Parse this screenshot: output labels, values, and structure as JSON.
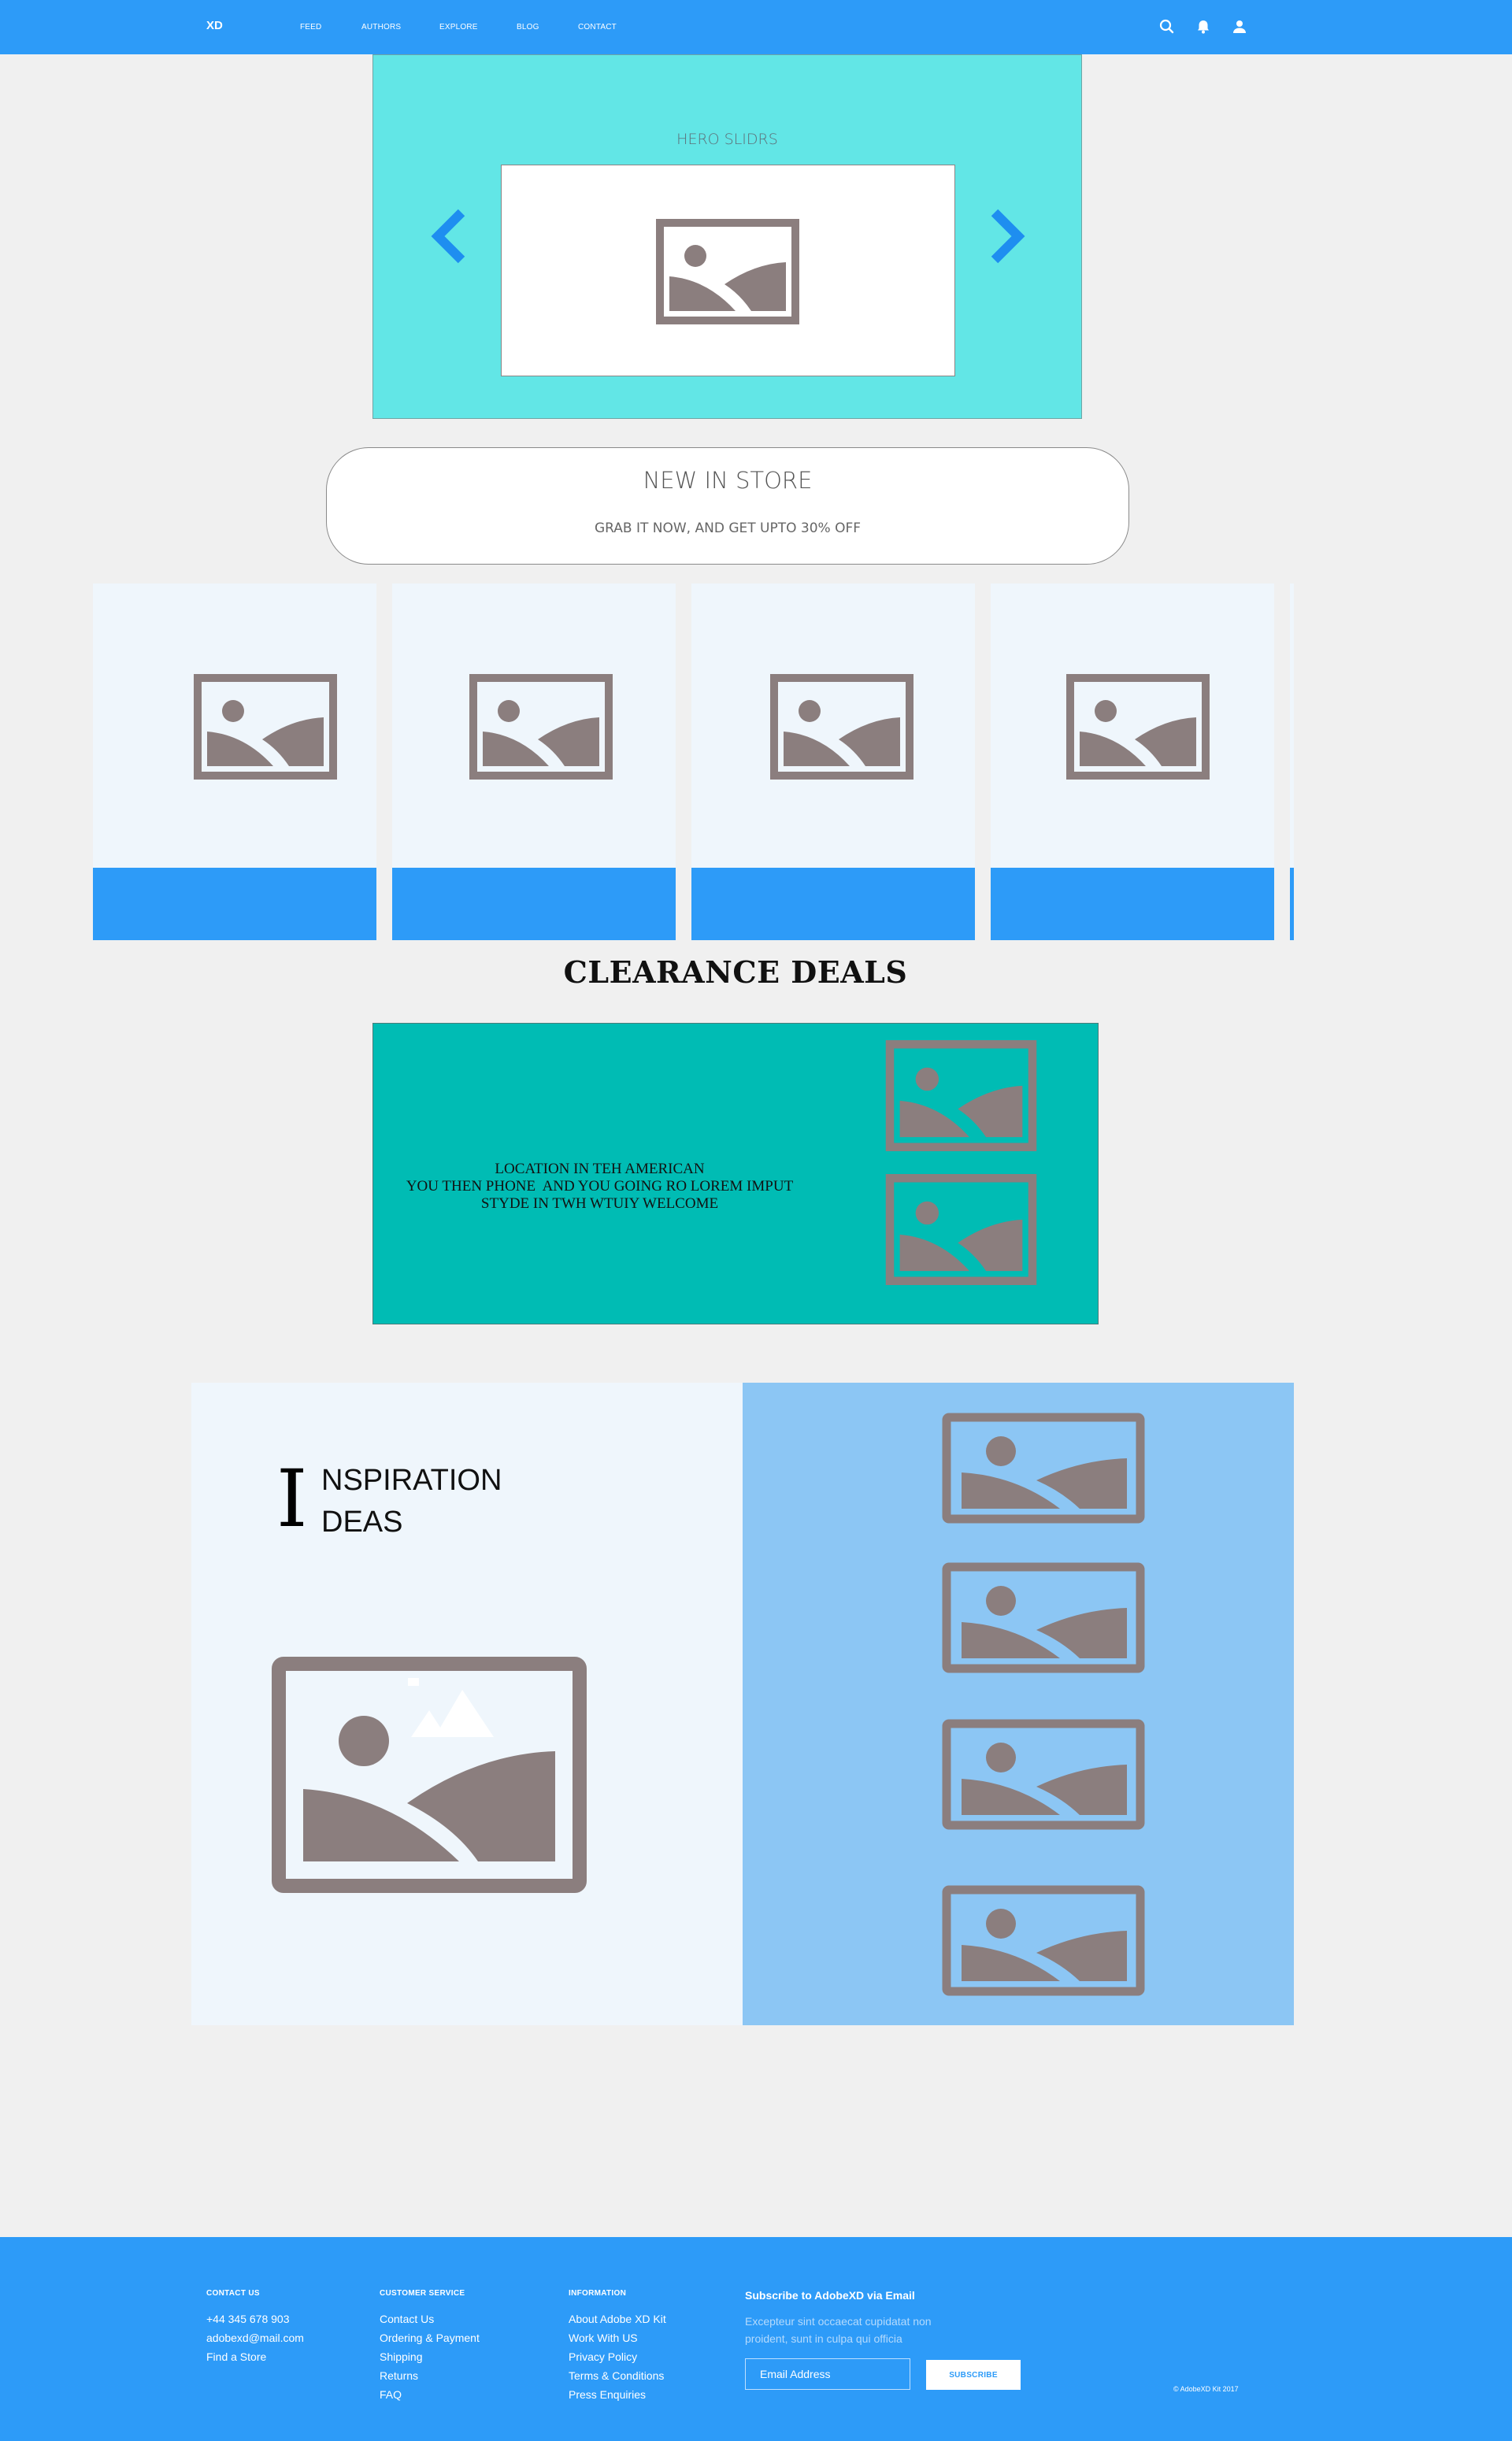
{
  "nav": {
    "logo": "XD",
    "links": [
      "FEED",
      "AUTHORS",
      "EXPLORE",
      "BLOG",
      "CONTACT"
    ],
    "icons": [
      "search-icon",
      "bell-icon",
      "user-icon"
    ]
  },
  "hero": {
    "title": "HERO SLIDRS",
    "prev_icon": "chevron-left-icon",
    "next_icon": "chevron-right-icon"
  },
  "store": {
    "title": "NEW IN STORE",
    "subtitle": "GRAB IT NOW, AND GET UPTO 30% OFF"
  },
  "clearance": {
    "title": "CLEARANCE DEALS",
    "text": "LOCATION IN TEH AMERICAN\nYOU THEN PHONE  AND YOU GOING RO LOREM IMPUT\nSTYDE IN TWH WTUIY WELCOME"
  },
  "inspiration": {
    "drop_cap": "I",
    "line1": "NSPIRATION",
    "line2": "DEAS"
  },
  "footer": {
    "contact": {
      "heading": "CONTACT US",
      "items": [
        "+44 345 678 903",
        "adobexd@mail.com",
        "Find a Store"
      ]
    },
    "customer": {
      "heading": "CUSTOMER SERVICE",
      "items": [
        "Contact Us",
        "Ordering & Payment",
        "Shipping",
        "Returns",
        "FAQ"
      ]
    },
    "information": {
      "heading": "INFORMATION",
      "items": [
        "About Adobe XD Kit",
        "Work With US",
        "Privacy Policy",
        "Terms & Conditions",
        "Press Enquiries"
      ]
    },
    "subscribe": {
      "title": "Subscribe to AdobeXD via Email",
      "description": "Excepteur sint occaecat cupidatat non proident, sunt in culpa qui officia",
      "placeholder": "Email Address",
      "button": "SUBSCRIBE"
    },
    "copyright": "© AdobeXD Kit 2017"
  },
  "colors": {
    "primary": "#2d9bf8",
    "hero_bg": "#62e6e6",
    "clearance_bg": "#00bcb4",
    "placeholder_icon": "#8b7e7e"
  }
}
